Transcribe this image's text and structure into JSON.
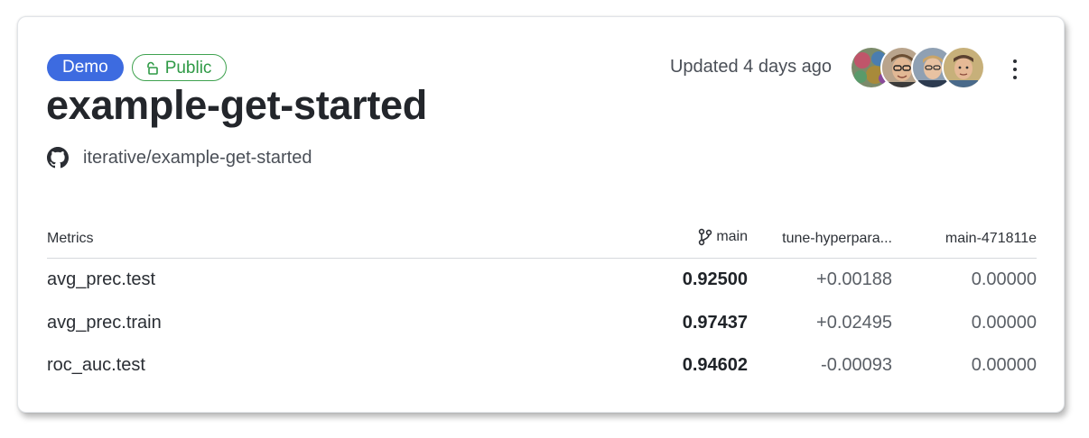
{
  "project": {
    "badges": {
      "demo": "Demo",
      "public": "Public"
    },
    "title": "example-get-started",
    "repo": "iterative/example-get-started",
    "updated": "Updated 4 days ago",
    "avatars": [
      {
        "name": "avatar-1-icon"
      },
      {
        "name": "avatar-2-icon"
      },
      {
        "name": "avatar-3-icon"
      },
      {
        "name": "avatar-4-icon"
      }
    ]
  },
  "colors": {
    "demo_badge": "#3d6be0",
    "public_badge": "#3fa24f",
    "title": "#23262b"
  },
  "table": {
    "headers": {
      "metrics": "Metrics",
      "main": "main",
      "col2": "tune-hyperpara...",
      "col3": "main-471811e"
    },
    "rows": [
      {
        "metric": "avg_prec.test",
        "main": "0.92500",
        "col2": "+0.00188",
        "col3": "0.00000"
      },
      {
        "metric": "avg_prec.train",
        "main": "0.97437",
        "col2": "+0.02495",
        "col3": "0.00000"
      },
      {
        "metric": "roc_auc.test",
        "main": "0.94602",
        "col2": "-0.00093",
        "col3": "0.00000"
      }
    ]
  }
}
